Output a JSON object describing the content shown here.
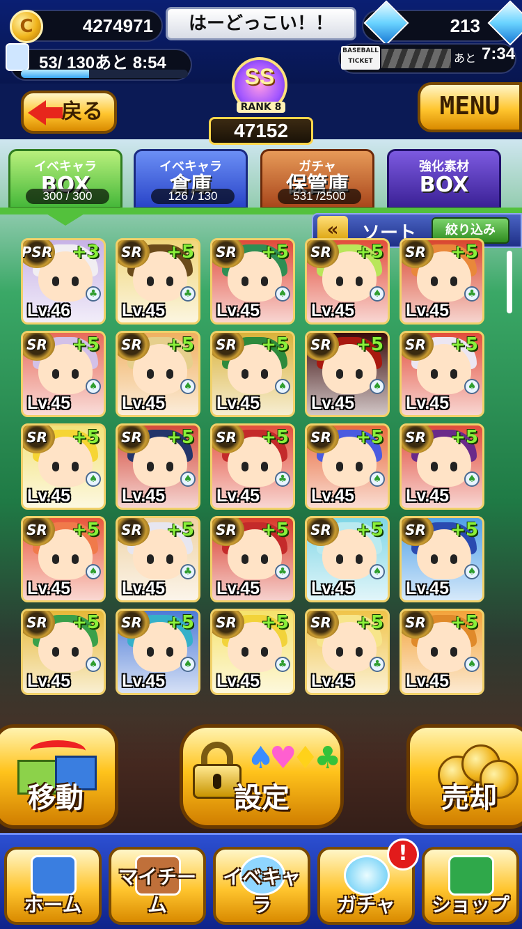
{
  "header": {
    "coins": "4274971",
    "coin_icon_glyph": "C",
    "player_name": "はーどっこい！！",
    "gems": "213",
    "stamina": "53/ 130あと 8:54",
    "stamina_fill": 0.41,
    "ticket_label_top": "BASEBALL",
    "ticket_label_bottom": "TICKET",
    "ticket_time_label": "あと",
    "ticket_time": "7:34",
    "rank_grade": "SS",
    "rank_word": "RANK",
    "rank_level": "8",
    "rank_score": "47152",
    "back_label": "戻る",
    "menu_label": "MENU"
  },
  "tabs": [
    {
      "line1": "イベキャラ",
      "line2": "BOX",
      "count": "300 / 300",
      "active": true
    },
    {
      "line1": "イベキャラ",
      "line2": "倉庫",
      "count": "126 / 130",
      "active": false
    },
    {
      "line1": "ガチャ",
      "line2": "保管庫",
      "count": "531 /2500",
      "active": false
    },
    {
      "line1": "強化素材",
      "line2": "BOX",
      "count": "",
      "active": false
    }
  ],
  "sort": {
    "arrows": "«",
    "label": "ソート",
    "filter": "絞り込みOFF"
  },
  "cards": [
    {
      "rarity": "PSR",
      "plus": "+3",
      "level": "Lv.46",
      "suit": "♣",
      "hair": "#f1eef2",
      "bg": "#c7b2e6"
    },
    {
      "rarity": "SR",
      "plus": "+5",
      "level": "Lv.45",
      "suit": "♣",
      "hair": "#6b4b1a",
      "bg": "#f0d67a"
    },
    {
      "rarity": "SR",
      "plus": "+5",
      "level": "Lv.45",
      "suit": "♠",
      "hair": "#2f8e54",
      "bg": "#e04a3a"
    },
    {
      "rarity": "SR",
      "plus": "+5",
      "level": "Lv.45",
      "suit": "♠",
      "hair": "#b9e65a",
      "bg": "#e24d3b"
    },
    {
      "rarity": "SR",
      "plus": "+5",
      "level": "Lv.45",
      "suit": "♣",
      "hair": "#e9883a",
      "bg": "#d9462e"
    },
    {
      "rarity": "SR",
      "plus": "+5",
      "level": "Lv.45",
      "suit": "♠",
      "hair": "#d3c1e8",
      "bg": "#e76a5a"
    },
    {
      "rarity": "SR",
      "plus": "+5",
      "level": "Lv.45",
      "suit": "♠",
      "hair": "#e6cf8c",
      "bg": "#f0b060"
    },
    {
      "rarity": "SR",
      "plus": "+5",
      "level": "Lv.45",
      "suit": "♠",
      "hair": "#2d8a3c",
      "bg": "#d9b23a"
    },
    {
      "rarity": "SR",
      "plus": "+5",
      "level": "Lv.45",
      "suit": "♠",
      "hair": "#a8180f",
      "bg": "#3a0a0a"
    },
    {
      "rarity": "SR",
      "plus": "+5",
      "level": "Lv.45",
      "suit": "♠",
      "hair": "#ece6f2",
      "bg": "#e24d3b"
    },
    {
      "rarity": "SR",
      "plus": "+5",
      "level": "Lv.45",
      "suit": "♠",
      "hair": "#f6d534",
      "bg": "#f3e27a"
    },
    {
      "rarity": "SR",
      "plus": "+5",
      "level": "Lv.45",
      "suit": "♠",
      "hair": "#23356a",
      "bg": "#d4493a"
    },
    {
      "rarity": "SR",
      "plus": "+5",
      "level": "Lv.45",
      "suit": "♣",
      "hair": "#c42a2a",
      "bg": "#e24d3b"
    },
    {
      "rarity": "SR",
      "plus": "+5",
      "level": "Lv.45",
      "suit": "♠",
      "hair": "#4a5be0",
      "bg": "#e86a3c"
    },
    {
      "rarity": "SR",
      "plus": "+5",
      "level": "Lv.45",
      "suit": "♠",
      "hair": "#6a2a8a",
      "bg": "#e04a3a"
    },
    {
      "rarity": "SR",
      "plus": "+5",
      "level": "Lv.45",
      "suit": "♠",
      "hair": "#f07a4a",
      "bg": "#e9573c"
    },
    {
      "rarity": "SR",
      "plus": "+5",
      "level": "Lv.45",
      "suit": "♣",
      "hair": "#e7e6f0",
      "bg": "#efd2a4"
    },
    {
      "rarity": "SR",
      "plus": "+5",
      "level": "Lv.45",
      "suit": "♣",
      "hair": "#c42a2a",
      "bg": "#d83a2a"
    },
    {
      "rarity": "SR",
      "plus": "+5",
      "level": "Lv.45",
      "suit": "♠",
      "hair": "#b9eaf0",
      "bg": "#7fd6e6"
    },
    {
      "rarity": "SR",
      "plus": "+5",
      "level": "Lv.45",
      "suit": "♠",
      "hair": "#2a4ab0",
      "bg": "#4fa0e8"
    },
    {
      "rarity": "SR",
      "plus": "+5",
      "level": "Lv.45",
      "suit": "♠",
      "hair": "#39a04a",
      "bg": "#e6b838"
    },
    {
      "rarity": "SR",
      "plus": "+5",
      "level": "Lv.45",
      "suit": "♠",
      "hair": "#34b0c9",
      "bg": "#4c7ad6"
    },
    {
      "rarity": "SR",
      "plus": "+5",
      "level": "Lv.45",
      "suit": "♣",
      "hair": "#f2d33a",
      "bg": "#f6e26a"
    },
    {
      "rarity": "SR",
      "plus": "+5",
      "level": "Lv.45",
      "suit": "♣",
      "hair": "#f7e58a",
      "bg": "#f0c44a"
    },
    {
      "rarity": "SR",
      "plus": "+5",
      "level": "Lv.45",
      "suit": "♠",
      "hair": "#e08a2a",
      "bg": "#f3a33a"
    }
  ],
  "actions": {
    "move": "移動",
    "set": "設定",
    "sell": "売却",
    "set_suits": [
      "♠",
      "♥",
      "♦",
      "♣"
    ]
  },
  "nav": [
    {
      "label": "ホーム",
      "icon": "home-icon"
    },
    {
      "label": "マイチーム",
      "icon": "team-icon"
    },
    {
      "label": "イベキャラ",
      "icon": "event-character-icon"
    },
    {
      "label": "ガチャ",
      "icon": "gacha-icon"
    },
    {
      "label": "ショップ",
      "icon": "shop-icon"
    }
  ],
  "gacha_alert": "!",
  "colors": {
    "accent_gold": "#ffc52e",
    "nav_blue": "#2c4fd1",
    "tab_green": "#53c13c"
  }
}
